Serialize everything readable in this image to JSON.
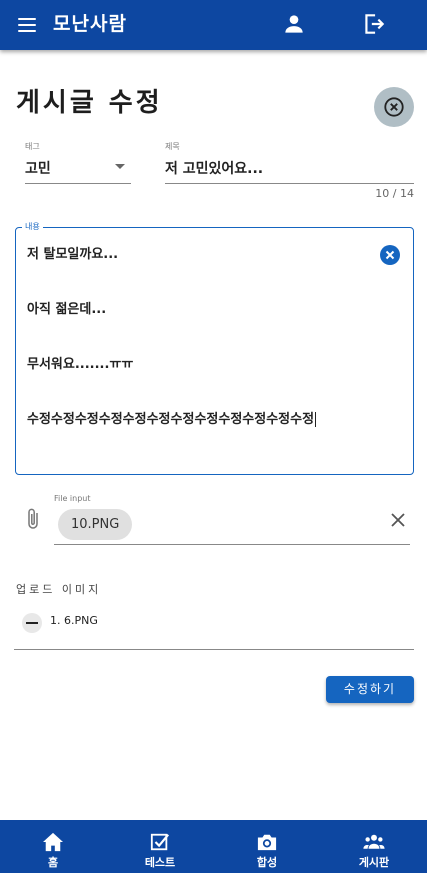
{
  "app": {
    "title": "모난사람"
  },
  "header": {
    "icons": [
      "menu-icon",
      "account-icon",
      "logout-icon"
    ]
  },
  "page": {
    "title": "게시글 수정"
  },
  "form": {
    "tag": {
      "label": "태그",
      "value": "고민",
      "options_visible": [
        "고민"
      ]
    },
    "title": {
      "label": "제목",
      "value": "저 고민있어요...",
      "counter": "10 / 14"
    },
    "content": {
      "label": "내용",
      "lines": [
        "저 탈모일까요...",
        "아직 젊은데...",
        "무서워요.......ㅠㅠ",
        "수정수정수정수정수정수정수정수정수정수정수정수정"
      ]
    },
    "file_input": {
      "label": "File input",
      "chip": "10.PNG"
    },
    "uploaded": {
      "heading": "업로드 이미지",
      "items": [
        "1. 6.PNG"
      ]
    },
    "submit_label": "수정하기"
  },
  "bottom_nav": [
    {
      "label": "홈",
      "icon": "home-icon"
    },
    {
      "label": "테스트",
      "icon": "checkbox-icon"
    },
    {
      "label": "합성",
      "icon": "camera-icon"
    },
    {
      "label": "게시판",
      "icon": "group-icon"
    }
  ],
  "colors": {
    "primary": "#0d47a1",
    "accent": "#1565c0",
    "fab": "#b0bec5"
  }
}
